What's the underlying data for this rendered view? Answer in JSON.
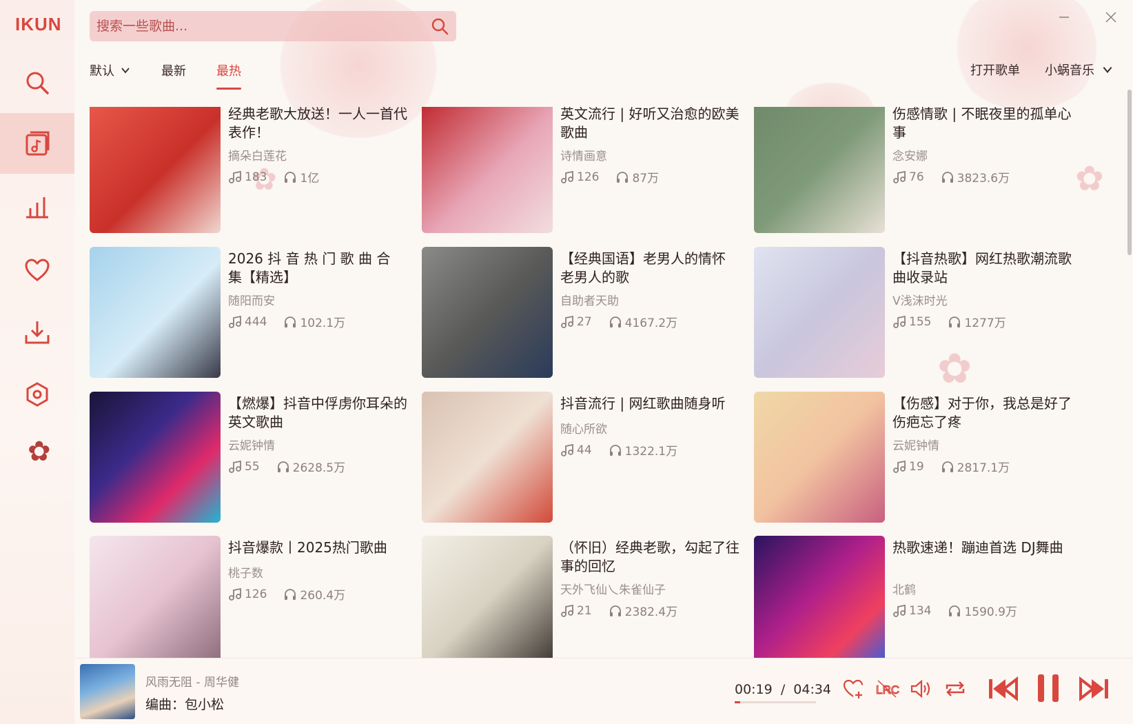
{
  "app": {
    "logo": "IKUN",
    "accent": "#d9473f"
  },
  "sidebar": {
    "items": [
      {
        "name": "search",
        "icon": "search-icon"
      },
      {
        "name": "playlist",
        "icon": "music-note-square-icon",
        "active": true
      },
      {
        "name": "charts",
        "icon": "bar-chart-icon"
      },
      {
        "name": "favorites",
        "icon": "heart-icon"
      },
      {
        "name": "downloads",
        "icon": "download-icon"
      },
      {
        "name": "settings",
        "icon": "hexagon-gear-icon"
      }
    ]
  },
  "search": {
    "placeholder": "搜索一些歌曲..."
  },
  "tabs": {
    "default_label": "默认",
    "latest_label": "最新",
    "hottest_label": "最热",
    "active": "最热"
  },
  "header": {
    "open_playlist": "打开歌单",
    "source": "小蜗音乐"
  },
  "playlists": [
    {
      "title": "经典老歌大放送！一人一首代表作！",
      "author": "摘朵白莲花",
      "songs": "183",
      "plays": "1亿"
    },
    {
      "title": "英文流行 | 好听又治愈的欧美歌曲",
      "author": "诗情画意",
      "songs": "126",
      "plays": "87万"
    },
    {
      "title": "伤感情歌 | 不眠夜里的孤单心事",
      "author": "念安娜",
      "songs": "76",
      "plays": "3823.6万"
    },
    {
      "title": "2026 抖 音 热 门 歌 曲 合 集【精选】",
      "author": "随阳而安",
      "songs": "444",
      "plays": "102.1万"
    },
    {
      "title": "【经典国语】老男人的情怀 老男人的歌",
      "author": "自助者天助",
      "songs": "27",
      "plays": "4167.2万"
    },
    {
      "title": "【抖音热歌】网红热歌潮流歌曲收录站",
      "author": "V浅沫时光",
      "songs": "155",
      "plays": "1277万"
    },
    {
      "title": "【燃爆】抖音中俘虏你耳朵的英文歌曲",
      "author": "云妮钟情",
      "songs": "55",
      "plays": "2628.5万"
    },
    {
      "title": "抖音流行 | 网红歌曲随身听",
      "author": "随心所欲",
      "songs": "44",
      "plays": "1322.1万"
    },
    {
      "title": "【伤感】对于你，我总是好了伤疤忘了疼",
      "author": "云妮钟情",
      "songs": "19",
      "plays": "2817.1万"
    },
    {
      "title": "抖音爆款丨2025热门歌曲",
      "author": "桃子数",
      "songs": "126",
      "plays": "260.4万"
    },
    {
      "title": "（怀旧）经典老歌，勾起了往事的回忆",
      "author": "天外飞仙乀朱雀仙子",
      "songs": "21",
      "plays": "2382.4万"
    },
    {
      "title": "热歌速递！蹦迪首选 DJ舞曲",
      "author": "北鹤",
      "songs": "134",
      "plays": "1590.9万"
    }
  ],
  "player": {
    "song": "风雨无阻 - 周华健",
    "lyric": "编曲：包小松",
    "current_time": "00:19",
    "separator": "/",
    "total_time": "04:34",
    "progress": 0.07
  }
}
